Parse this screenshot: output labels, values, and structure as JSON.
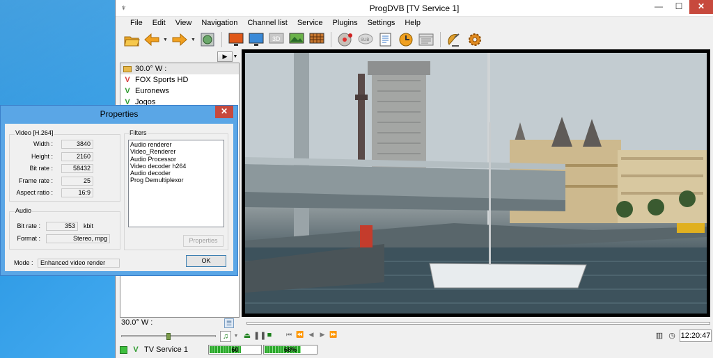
{
  "window": {
    "title": "ProgDVB [TV Service 1]",
    "min_label": "—",
    "max_label": "☐",
    "close_label": "✕"
  },
  "menu": [
    "File",
    "Edit",
    "View",
    "Navigation",
    "Channel list",
    "Service",
    "Plugins",
    "Settings",
    "Help"
  ],
  "toolbar_icons": [
    "open-folder-icon",
    "back-arrow-icon",
    "forward-arrow-icon",
    "scan-icon",
    "tv-screen-icon",
    "tv-channel-icon",
    "3d-icon",
    "picture-icon",
    "mosaic-icon",
    "record-disc-icon",
    "subtitles-icon",
    "teletext-icon",
    "scheduler-clock-icon",
    "epg-icon",
    "satellite-dish-icon",
    "settings-gear-icon"
  ],
  "channel_list": {
    "header": "30.0° W :",
    "items": [
      {
        "name": "FOX Sports HD",
        "color": "#d64040"
      },
      {
        "name": "Euronews",
        "color": "#2e9b2e"
      },
      {
        "name": "Jogos",
        "color": "#2e9b2e"
      }
    ]
  },
  "status": {
    "position": "30.0° W :",
    "service": "TV Service 1",
    "time": "12:20:47",
    "signal_level": "60",
    "signal_fraction": 0.6,
    "quality_level": "68%",
    "quality_fraction": 0.68,
    "volume_fraction": 0.5
  },
  "properties": {
    "title": "Properties",
    "close_label": "✕",
    "video_group": "Video [H.264]",
    "video": [
      {
        "label": "Width :",
        "value": "3840"
      },
      {
        "label": "Height :",
        "value": "2160"
      },
      {
        "label": "Bit rate :",
        "value": "58432"
      },
      {
        "label": "Frame rate :",
        "value": "25"
      },
      {
        "label": "Aspect ratio :",
        "value": "16:9"
      }
    ],
    "audio_group": "Audio",
    "audio_bitrate_label": "Bit rate :",
    "audio_bitrate_value": "353",
    "audio_bitrate_unit": "kbit",
    "format_label": "Format :",
    "format_value": "Stereo, mpg",
    "filters_group": "Filters",
    "filters": [
      "Audio renderer",
      "Video_Renderer",
      "Audio Processor",
      "Video decoder h264",
      "Audio decoder",
      "Prog Demultiplexor"
    ],
    "properties_button": "Properties",
    "mode_label": "Mode :",
    "mode_value": "Enhanced video render",
    "ok_button": "OK"
  },
  "colors": {
    "desktop": "#2b93de",
    "dialog_frame": "#5aa6e6",
    "close_red": "#c7493d",
    "signal_green": "#2aa82a"
  }
}
